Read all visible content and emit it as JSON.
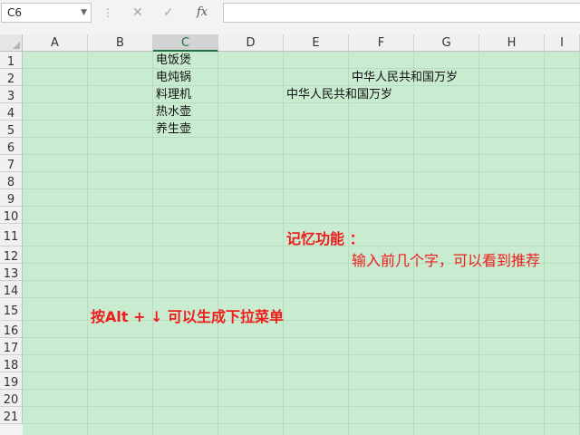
{
  "formula_bar": {
    "name_box": "C6",
    "cancel_glyph": "✕",
    "enter_glyph": "✓",
    "fx_label": "fx",
    "formula_value": ""
  },
  "columns": [
    "A",
    "B",
    "C",
    "D",
    "E",
    "F",
    "G",
    "H",
    "I"
  ],
  "selected_column": "C",
  "rows": [
    "1",
    "2",
    "3",
    "4",
    "5",
    "6",
    "7",
    "8",
    "9",
    "10",
    "11",
    "12",
    "13",
    "14",
    "15",
    "16",
    "17",
    "18",
    "19",
    "20",
    "21"
  ],
  "cells": {
    "C1": "电饭煲",
    "C2": "电炖锅",
    "C3": "料理机",
    "C4": "热水壶",
    "C5": "养生壶",
    "F2": "中华人民共和国万岁",
    "E3": "中华人民共和国万岁"
  },
  "annotations": {
    "memory_title": "记忆功能 ：",
    "memory_desc": "输入前几个字，可以看到推荐",
    "dropdown_tip": "按Alt + ↓ 可以生成下拉菜单"
  },
  "colors": {
    "sheet_background": "#c9ebcf",
    "annotation_red": "#ee1c1c",
    "excel_green": "#217346"
  }
}
